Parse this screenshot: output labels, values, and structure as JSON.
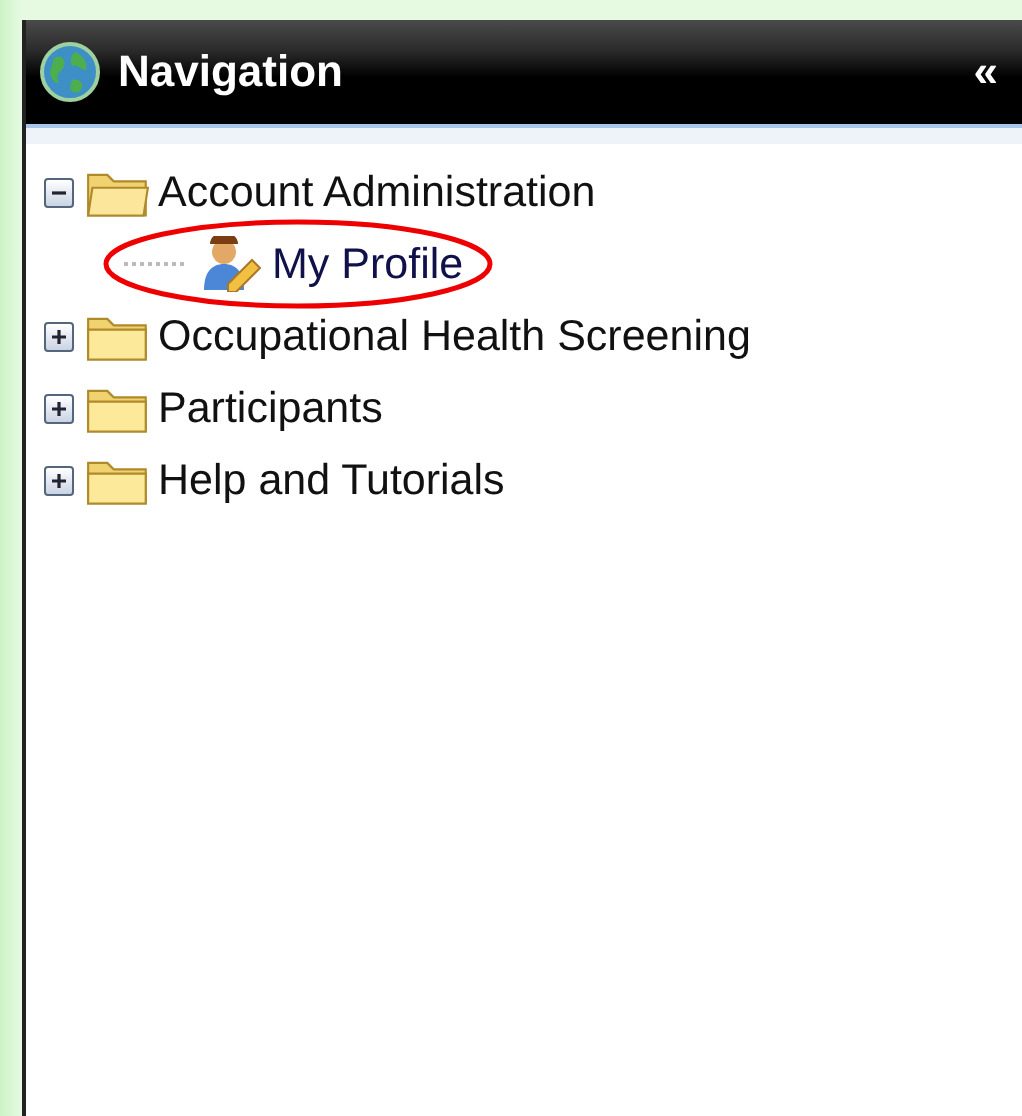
{
  "panel": {
    "title": "Navigation",
    "collapse_glyph": "«"
  },
  "tree": [
    {
      "label": "Account Administration",
      "kind": "folder",
      "expanded": true,
      "children": [
        {
          "label": "My Profile",
          "kind": "profile",
          "highlighted": true
        }
      ]
    },
    {
      "label": "Occupational Health Screening",
      "kind": "folder",
      "expanded": false
    },
    {
      "label": "Participants",
      "kind": "folder",
      "expanded": false
    },
    {
      "label": "Help and Tutorials",
      "kind": "folder",
      "expanded": false
    }
  ]
}
